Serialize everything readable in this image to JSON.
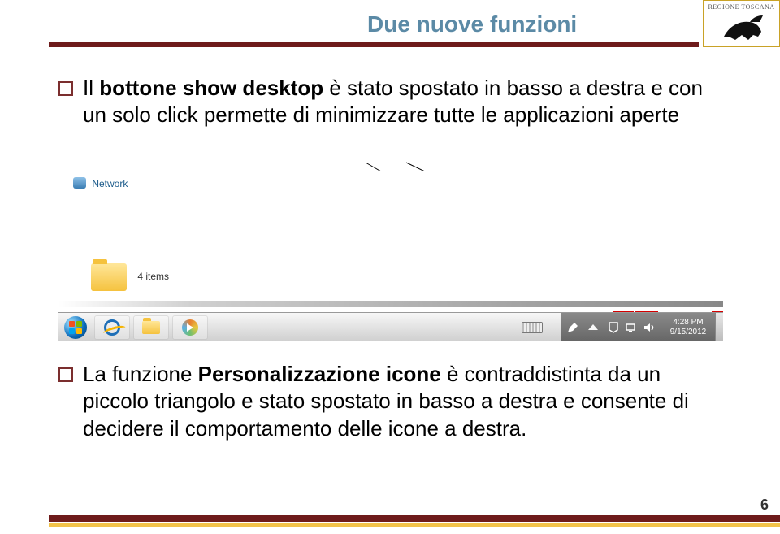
{
  "logo": {
    "label": "REGIONE TOSCANA"
  },
  "title": "Due nuove funzioni",
  "bullets": {
    "b1_pre": "Il ",
    "b1_bold": "bottone show desktop",
    "b1_post": " è stato spostato in basso a destra e con un solo click permette di minimizzare tutte le applicazioni aperte",
    "b2_pre": "La funzione ",
    "b2_bold": "Personalizzazione icone",
    "b2_post": " è contraddistinta da un piccolo triangolo e stato spostato in basso a destra e consente di decidere il comportamento delle icone a destra."
  },
  "screenshot": {
    "network_label": "Network",
    "folder_label": "4 items",
    "clock_time": "4:28 PM",
    "clock_date": "9/15/2012"
  },
  "icons": {
    "start": "start-orb",
    "ie": "ie-icon",
    "explorer": "folder-icon",
    "wmp": "media-player-icon",
    "keyboard": "keyboard-icon",
    "triangle": "tray-triangle",
    "pen": "pen-icon",
    "action": "action-center-icon",
    "net": "network-tray-icon",
    "vol": "volume-icon",
    "show_desktop": "show-desktop-button"
  },
  "page_number": "6"
}
